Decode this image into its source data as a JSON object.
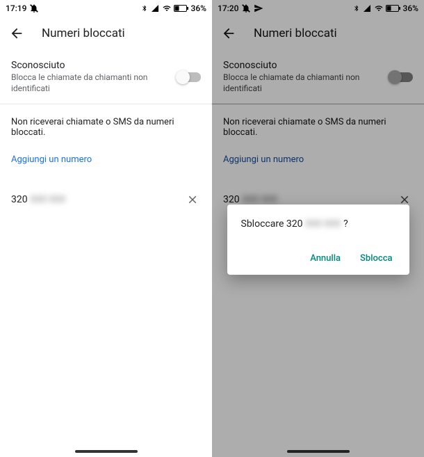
{
  "left": {
    "status": {
      "time": "17:19",
      "battery": "36%"
    },
    "title": "Numeri bloccati",
    "unknown": {
      "title": "Sconosciuto",
      "sub": "Blocca le chiamate da chiamanti non identificati"
    },
    "info": "Non riceverai chiamate o SMS da numeri bloccati.",
    "add": "Aggiungi un numero",
    "number_prefix": "320",
    "number_blur": "000 000"
  },
  "right": {
    "status": {
      "time": "17:20",
      "battery": "36%"
    },
    "title": "Numeri bloccati",
    "unknown": {
      "title": "Sconosciuto",
      "sub": "Blocca le chiamate da chiamanti non identificati"
    },
    "info": "Non riceverai chiamate o SMS da numeri bloccati.",
    "add": "Aggiungi un numero",
    "number_prefix": "320",
    "number_blur": "000 000",
    "dialog": {
      "msg_pre": "Sbloccare 320",
      "msg_blur": "000 000",
      "msg_post": "?",
      "cancel": "Annulla",
      "confirm": "Sblocca"
    }
  }
}
